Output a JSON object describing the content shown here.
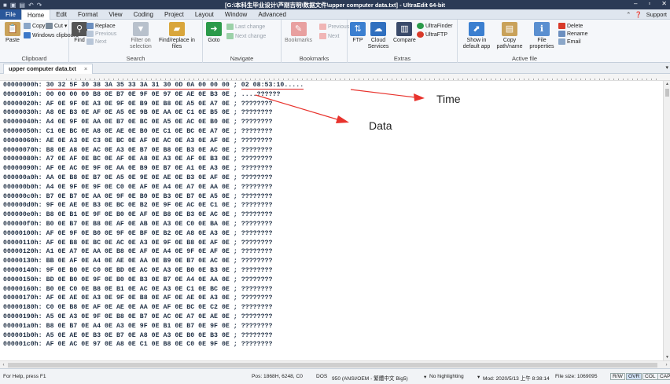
{
  "window": {
    "title": "[G:\\本科生毕业设计\\芦刚吉明\\数据文件\\upper computer data.txt] - UltraEdit 64-bit",
    "controls": [
      "–",
      "▫",
      "✕"
    ]
  },
  "menu": {
    "items": [
      "File",
      "Home",
      "Edit",
      "Format",
      "View",
      "Coding",
      "Project",
      "Layout",
      "Window",
      "Advanced"
    ],
    "support": "Support"
  },
  "ribbon": {
    "clipboard": {
      "label": "Clipboard",
      "paste": "Paste",
      "copy": "Copy",
      "cut": "Cut",
      "windows_clipboard": "Windows clipboard"
    },
    "search": {
      "label": "Search",
      "find": "Find",
      "replace": "Replace",
      "previous": "Previous",
      "next": "Next",
      "filter_on_selection": "Filter on selection",
      "find_replace_in_files": "Find/replace in files"
    },
    "navigate": {
      "label": "Navigate",
      "goto": "Goto",
      "last_change": "Last change",
      "next_change": "Next change"
    },
    "bookmarks": {
      "label": "Bookmarks",
      "bookmarks": "Bookmarks",
      "previous": "Previous",
      "next": "Next"
    },
    "extras": {
      "label": "Extras",
      "ftp": "FTP",
      "cloud_services": "Cloud Services",
      "compare": "Compare",
      "ultrafinder": "UltraFinder",
      "ultraftp": "UltraFTP"
    },
    "active_file": {
      "label": "Active file",
      "show_in_default_app": "Show in default app",
      "copy_path_name": "Copy path/name",
      "file_properties": "File properties",
      "delete": "Delete",
      "rename": "Rename",
      "email": "Email"
    }
  },
  "tabs": [
    {
      "label": "upper computer data.txt",
      "close": "×"
    }
  ],
  "hex": {
    "rows": [
      {
        "offset": "00000000h:",
        "bytes": "30 32 5F 30 38 3A 35 33 3A 31 30 0D 0A 00 00 00",
        "ascii": "02 08:53:10....."
      },
      {
        "offset": "00000010h:",
        "bytes": "00 00 00 00 B8 0E B7 0E 9F 0E 97 0E AE 0E B3 0E",
        "ascii": "....??????"
      },
      {
        "offset": "00000020h:",
        "bytes": "AF 0E 9F 0E A3 0E 9F 0E B9 0E B8 0E A5 0E A7 0E",
        "ascii": "????????"
      },
      {
        "offset": "00000030h:",
        "bytes": "A8 0E B3 0E AF 0E A5 0E 9B 0E AA 0E C1 0E B5 0E",
        "ascii": "????????"
      },
      {
        "offset": "00000040h:",
        "bytes": "A4 0E 9F 0E AA 0E B7 0E BC 0E A5 0E AC 0E B0 0E",
        "ascii": "????????"
      },
      {
        "offset": "00000050h:",
        "bytes": "C1 0E BC 0E A8 0E AE 0E B0 0E C1 0E BC 0E A7 0E",
        "ascii": "????????"
      },
      {
        "offset": "00000060h:",
        "bytes": "AE 0E A3 0E C3 0E BC 0E AF 0E AC 0E A3 0E AF 0E",
        "ascii": "????????"
      },
      {
        "offset": "00000070h:",
        "bytes": "B8 0E A8 0E AC 0E A3 0E B7 0E B8 0E B3 0E AC 0E",
        "ascii": "????????"
      },
      {
        "offset": "00000080h:",
        "bytes": "A7 0E AF 0E BC 0E AF 0E A8 0E A3 0E AF 0E B3 0E",
        "ascii": "????????"
      },
      {
        "offset": "00000090h:",
        "bytes": "AF 0E AC 0E 9F 0E AA 0E B9 0E B7 0E A1 0E A3 0E",
        "ascii": "????????"
      },
      {
        "offset": "000000a0h:",
        "bytes": "AA 0E B8 0E B7 0E A5 0E 9E 0E AE 0E B3 0E AF 0E",
        "ascii": "????????"
      },
      {
        "offset": "000000b0h:",
        "bytes": "A4 0E 9F 0E 9F 0E C0 0E AF 0E A4 0E A7 0E AA 0E",
        "ascii": "????????"
      },
      {
        "offset": "000000c0h:",
        "bytes": "B7 0E B7 0E AA 0E 9F 0E B0 0E B3 0E B7 0E A5 0E",
        "ascii": "????????"
      },
      {
        "offset": "000000d0h:",
        "bytes": "9F 0E AE 0E B3 0E BC 0E B2 0E 9F 0E AC 0E C1 0E",
        "ascii": "????????"
      },
      {
        "offset": "000000e0h:",
        "bytes": "B8 0E B1 0E 9F 0E B0 0E AF 0E B8 0E B3 0E AC 0E",
        "ascii": "????????"
      },
      {
        "offset": "000000f0h:",
        "bytes": "B0 0E B7 0E B8 0E AF 0E AB 0E A3 0E C0 0E BA 0E",
        "ascii": "????????"
      },
      {
        "offset": "00000100h:",
        "bytes": "AF 0E 9F 0E B0 0E 9F 0E BF 0E B2 0E A8 0E A3 0E",
        "ascii": "????????"
      },
      {
        "offset": "00000110h:",
        "bytes": "AF 0E B8 0E BC 0E AC 0E A3 0E 9F 0E B8 0E AF 0E",
        "ascii": "????????"
      },
      {
        "offset": "00000120h:",
        "bytes": "A1 0E A7 0E AA 0E B8 0E AF 0E A4 0E 9F 0E AF 0E",
        "ascii": "????????"
      },
      {
        "offset": "00000130h:",
        "bytes": "BB 0E AF 0E A4 0E AE 0E AA 0E B9 0E B7 0E AC 0E",
        "ascii": "????????"
      },
      {
        "offset": "00000140h:",
        "bytes": "9F 0E B0 0E C0 0E BD 0E AC 0E A3 0E B0 0E B3 0E",
        "ascii": "????????"
      },
      {
        "offset": "00000150h:",
        "bytes": "BD 0E B0 0E 9F 0E B0 0E B3 0E B7 0E A4 0E AA 0E",
        "ascii": "????????"
      },
      {
        "offset": "00000160h:",
        "bytes": "B0 0E C0 0E B8 0E B1 0E AC 0E A3 0E C1 0E BC 0E",
        "ascii": "????????"
      },
      {
        "offset": "00000170h:",
        "bytes": "AF 0E AE 0E A3 0E 9F 0E B8 0E AF 0E AE 0E A3 0E",
        "ascii": "????????"
      },
      {
        "offset": "00000180h:",
        "bytes": "C0 0E B8 0E AF 0E AE 0E AA 0E AF 0E BC 0E C2 0E",
        "ascii": "????????"
      },
      {
        "offset": "00000190h:",
        "bytes": "A5 0E A3 0E 9F 0E B8 0E B7 0E AC 0E A7 0E AE 0E",
        "ascii": "????????"
      },
      {
        "offset": "000001a0h:",
        "bytes": "B8 0E B7 0E A4 0E A3 0E 9F 0E B1 0E B7 0E 9F 0E",
        "ascii": "????????"
      },
      {
        "offset": "000001b0h:",
        "bytes": "A5 0E AE 0E B3 0E B7 0E A8 0E A3 0E B0 0E B3 0E",
        "ascii": "????????"
      },
      {
        "offset": "000001c0h:",
        "bytes": "AF 0E AC 0E 97 0E A8 0E C1 0E B8 0E C0 0E 9F 0E",
        "ascii": "????????"
      }
    ]
  },
  "annotations": {
    "time": "Time",
    "data": "Data",
    "arrow_color": "#e8332d"
  },
  "status": {
    "help": "For Help, press F1",
    "position": "Pos: 1868H, 6248, C0",
    "format": "DOS",
    "codepage": "950  (ANSI/OEM - 繁體中文 Big5)",
    "highlighting": "No highlighting",
    "modified": "Mod: 2020/5/13 上午 8:38:14",
    "file_size": "File size: 1069095",
    "rw": "R/W",
    "ovr": "OVR",
    "col": "COL",
    "cap": "CAP"
  }
}
